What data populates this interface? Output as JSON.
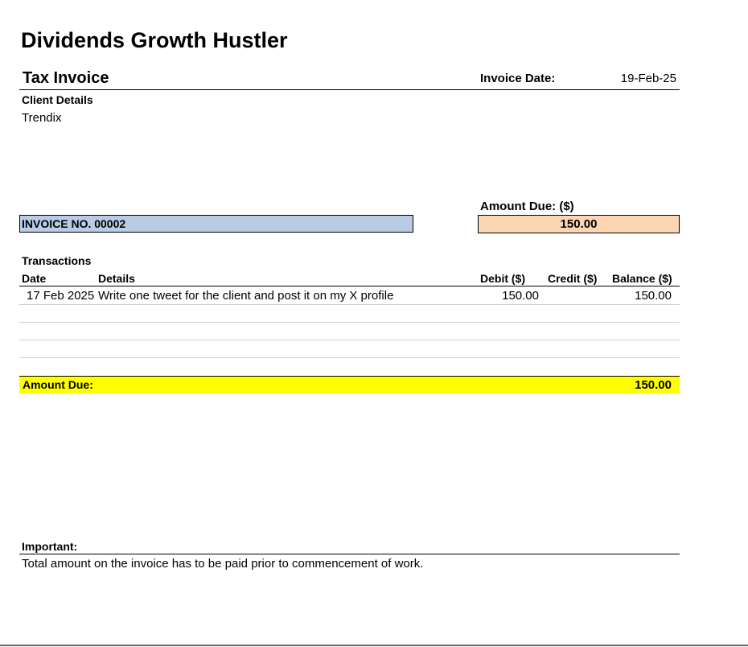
{
  "header": {
    "company": "Dividends Growth Hustler",
    "doc_title": "Tax Invoice",
    "invoice_date_label": "Invoice Date:",
    "invoice_date_value": "19-Feb-25"
  },
  "client": {
    "label": "Client Details",
    "name": "Trendix"
  },
  "summary": {
    "amount_due_label": "Amount Due: ($)",
    "invoice_no": "INVOICE NO. 00002",
    "amount_due_value": "150.00"
  },
  "transactions": {
    "section_label": "Transactions",
    "columns": {
      "date": "Date",
      "details": "Details",
      "debit": "Debit ($)",
      "credit": "Credit ($)",
      "balance": "Balance ($)"
    },
    "rows": [
      {
        "date": "17 Feb 2025",
        "details": "Write one tweet  for the client and post it on my X profile",
        "debit": "150.00",
        "credit": "",
        "balance": "150.00"
      }
    ]
  },
  "totals": {
    "label": "Amount Due:",
    "value": "150.00",
    "highlight_color": "#ffff00"
  },
  "notes": {
    "label": "Important:",
    "text": "Total amount on the invoice has to be paid prior to commencement of work."
  },
  "colors": {
    "invoice_no_fill": "#b8cce4",
    "amount_box_fill": "#fcd5b4"
  }
}
